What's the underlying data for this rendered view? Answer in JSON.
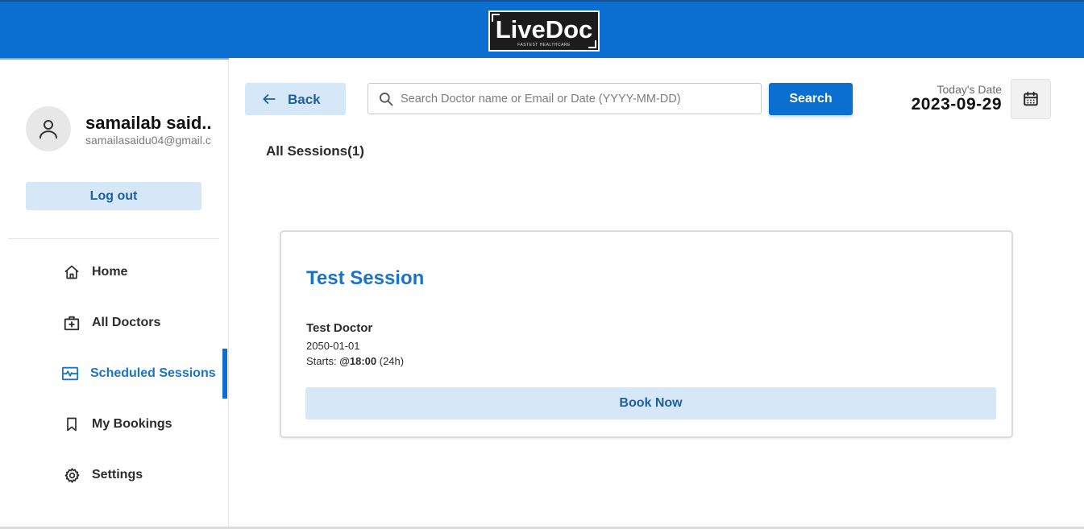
{
  "header": {
    "logo_text": "LiveDoc",
    "logo_tagline": "FASTEST HEALTHCARE",
    "brand_color": "#0a6fd1"
  },
  "user": {
    "name": "samailab said..",
    "email": "samailasaidu04@gmail.c",
    "avatar_icon": "user-icon",
    "logout_label": "Log out"
  },
  "sidebar": {
    "items": [
      {
        "label": "Home",
        "icon": "home-icon",
        "active": false
      },
      {
        "label": "All Doctors",
        "icon": "medical-bag-icon",
        "active": false
      },
      {
        "label": "Scheduled Sessions",
        "icon": "pulse-monitor-icon",
        "active": true
      },
      {
        "label": "My Bookings",
        "icon": "bookmark-icon",
        "active": false
      },
      {
        "label": "Settings",
        "icon": "gear-icon",
        "active": false
      }
    ]
  },
  "toolbar": {
    "back_label": "Back",
    "search_placeholder": "Search Doctor name or Email or Date (YYYY-MM-DD)",
    "search_value": "",
    "search_button_label": "Search",
    "today_label": "Today's Date",
    "today_value": "2023-09-29",
    "calendar_icon": "calendar-icon"
  },
  "sessions": {
    "heading": "All Sessions(1)",
    "items": [
      {
        "title": "Test Session",
        "doctor": "Test Doctor",
        "date": "2050-01-01",
        "starts_prefix": "Starts: ",
        "starts_time": "@18:00",
        "starts_suffix": " (24h)",
        "book_label": "Book Now"
      }
    ]
  }
}
